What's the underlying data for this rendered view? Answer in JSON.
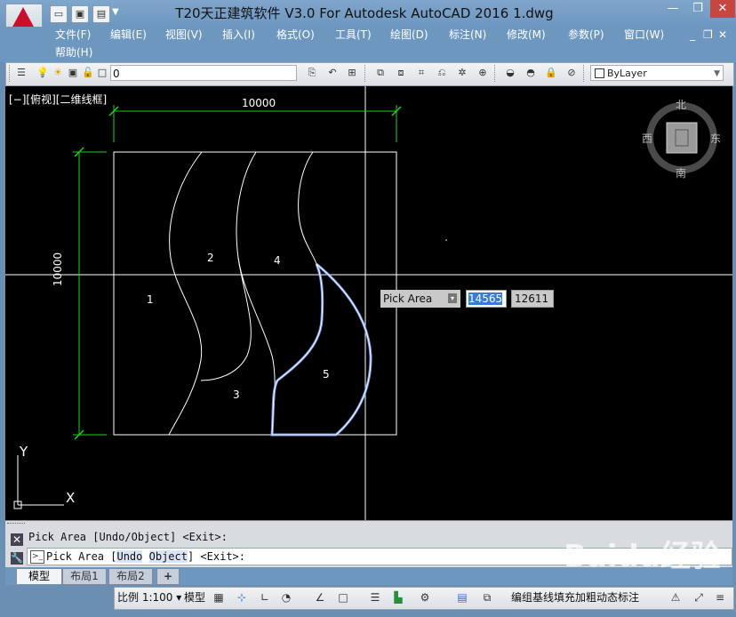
{
  "window": {
    "title": "T20天正建筑软件 V3.0 For Autodesk AutoCAD 2016      1.dwg",
    "minimize": "—",
    "restore": "❐",
    "close": "✕"
  },
  "menu": [
    "文件(F)",
    "编辑(E)",
    "视图(V)",
    "插入(I)",
    "格式(O)",
    "工具(T)",
    "绘图(D)",
    "标注(N)",
    "修改(M)",
    "参数(P)",
    "窗口(W)",
    "帮助(H)"
  ],
  "doc_controls": {
    "minimize": "_",
    "restore": "❐",
    "close": "✕"
  },
  "toolbar": {
    "layer_value": "0",
    "color_value": "ByLayer"
  },
  "viewport": {
    "label": "[−][俯视][二维线框]"
  },
  "viewcube": {
    "north": "北",
    "south": "南",
    "east": "东",
    "west": "西"
  },
  "drawing": {
    "dim_horizontal": "10000",
    "dim_vertical": "10000",
    "regions": [
      "1",
      "2",
      "3",
      "4",
      "5"
    ],
    "ucs_x": "X",
    "ucs_y": "Y"
  },
  "dynamic_input": {
    "prompt": "Pick Area",
    "x_value": "14565",
    "y_value": "12611"
  },
  "command": {
    "history": "Pick Area [Undo/Object] <Exit>:",
    "prompt_prefix": "Pick Area [",
    "opt_undo": "Undo",
    "opt_sep": " ",
    "opt_object": "Object",
    "prompt_suffix": "] <Exit>:"
  },
  "tabs": {
    "model": "模型",
    "layout1": "布局1",
    "layout2": "布局2",
    "add": "+"
  },
  "status": {
    "scale": "比例 1:100 ▾",
    "space": "模型",
    "tail": "编组基线填充加粗动态标注"
  },
  "watermark": "Baidu经验",
  "colors": {
    "titlebar": "#6e97c0",
    "drawing_bg": "#000000",
    "dimension": "#22cc22",
    "highlight": "#7fa7ff"
  }
}
